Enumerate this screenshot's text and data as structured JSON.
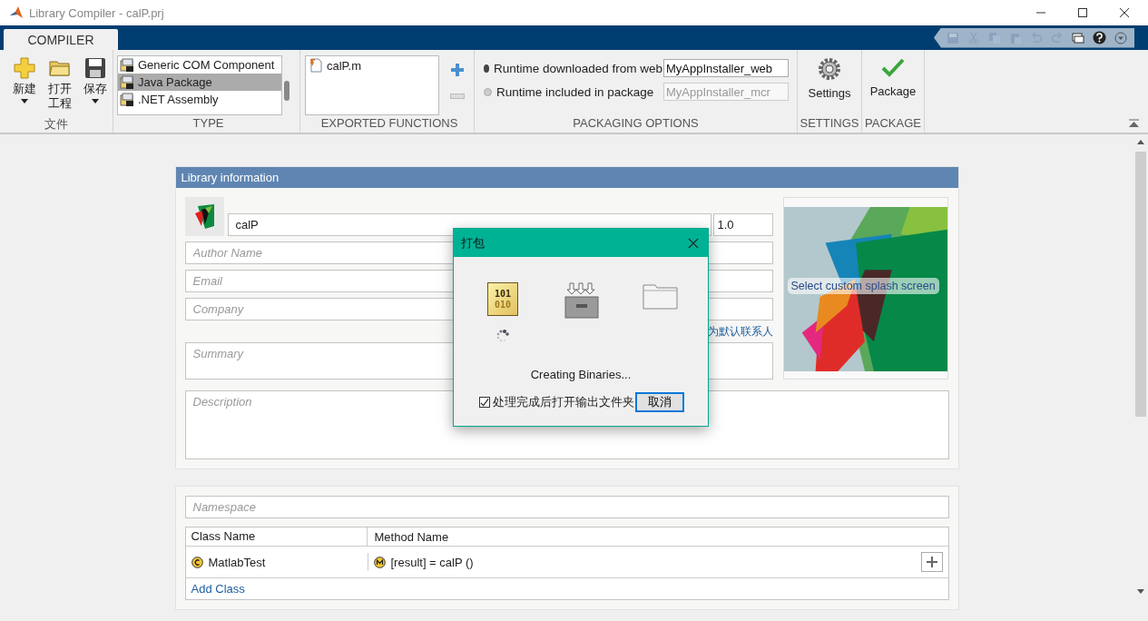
{
  "window": {
    "title": "Library Compiler - calP.prj"
  },
  "ribbon": {
    "tabs": [
      {
        "label": "COMPILER",
        "selected": true
      }
    ],
    "file_group": {
      "label": "文件",
      "buttons": [
        {
          "label": "新建",
          "kind": "new",
          "dropdown": true
        },
        {
          "label": "打开工程",
          "kind": "open",
          "dropdown": false
        },
        {
          "label": "保存",
          "kind": "save",
          "dropdown": true
        }
      ]
    },
    "type_group": {
      "label": "TYPE",
      "items": [
        {
          "label": "Generic COM Component",
          "selected": false
        },
        {
          "label": "Java Package",
          "selected": true
        },
        {
          "label": ".NET Assembly",
          "selected": false
        }
      ]
    },
    "exported_group": {
      "label": "EXPORTED FUNCTIONS",
      "files": [
        "calP.m"
      ]
    },
    "packaging_group": {
      "label": "PACKAGING OPTIONS",
      "options": [
        {
          "label": "Runtime downloaded from web",
          "selected": true,
          "value": "MyAppInstaller_web"
        },
        {
          "label": "Runtime included in package",
          "selected": false,
          "value": "MyAppInstaller_mcr"
        }
      ]
    },
    "settings_group": {
      "label": "SETTINGS",
      "button": "Settings"
    },
    "package_group": {
      "label": "PACKAGE",
      "button": "Package"
    }
  },
  "library_info": {
    "title": "Library information",
    "name": "calP",
    "version": "1.0",
    "fields": [
      {
        "placeholder": "Author Name"
      },
      {
        "placeholder": "Email"
      },
      {
        "placeholder": "Company"
      }
    ],
    "contact_link": "为默认联系人",
    "summary_placeholder": "Summary",
    "description_placeholder": "Description",
    "splash_label": "Select custom splash screen"
  },
  "classes": {
    "namespace_placeholder": "Namespace",
    "columns": [
      "Class Name",
      "Method Name"
    ],
    "rows": [
      {
        "class": "MatlabTest",
        "method": "[result] = calP ()"
      }
    ],
    "add_label": "Add Class"
  },
  "dialog": {
    "title": "打包",
    "steps": [
      {
        "kind": "binary",
        "lines": [
          "101",
          "010"
        ],
        "active": true
      },
      {
        "kind": "archive",
        "active": false
      },
      {
        "kind": "folder",
        "active": false
      }
    ],
    "status": "Creating Binaries...",
    "checkbox": {
      "label": "处理完成后打开输出文件夹",
      "checked": true
    },
    "button": "取消"
  }
}
